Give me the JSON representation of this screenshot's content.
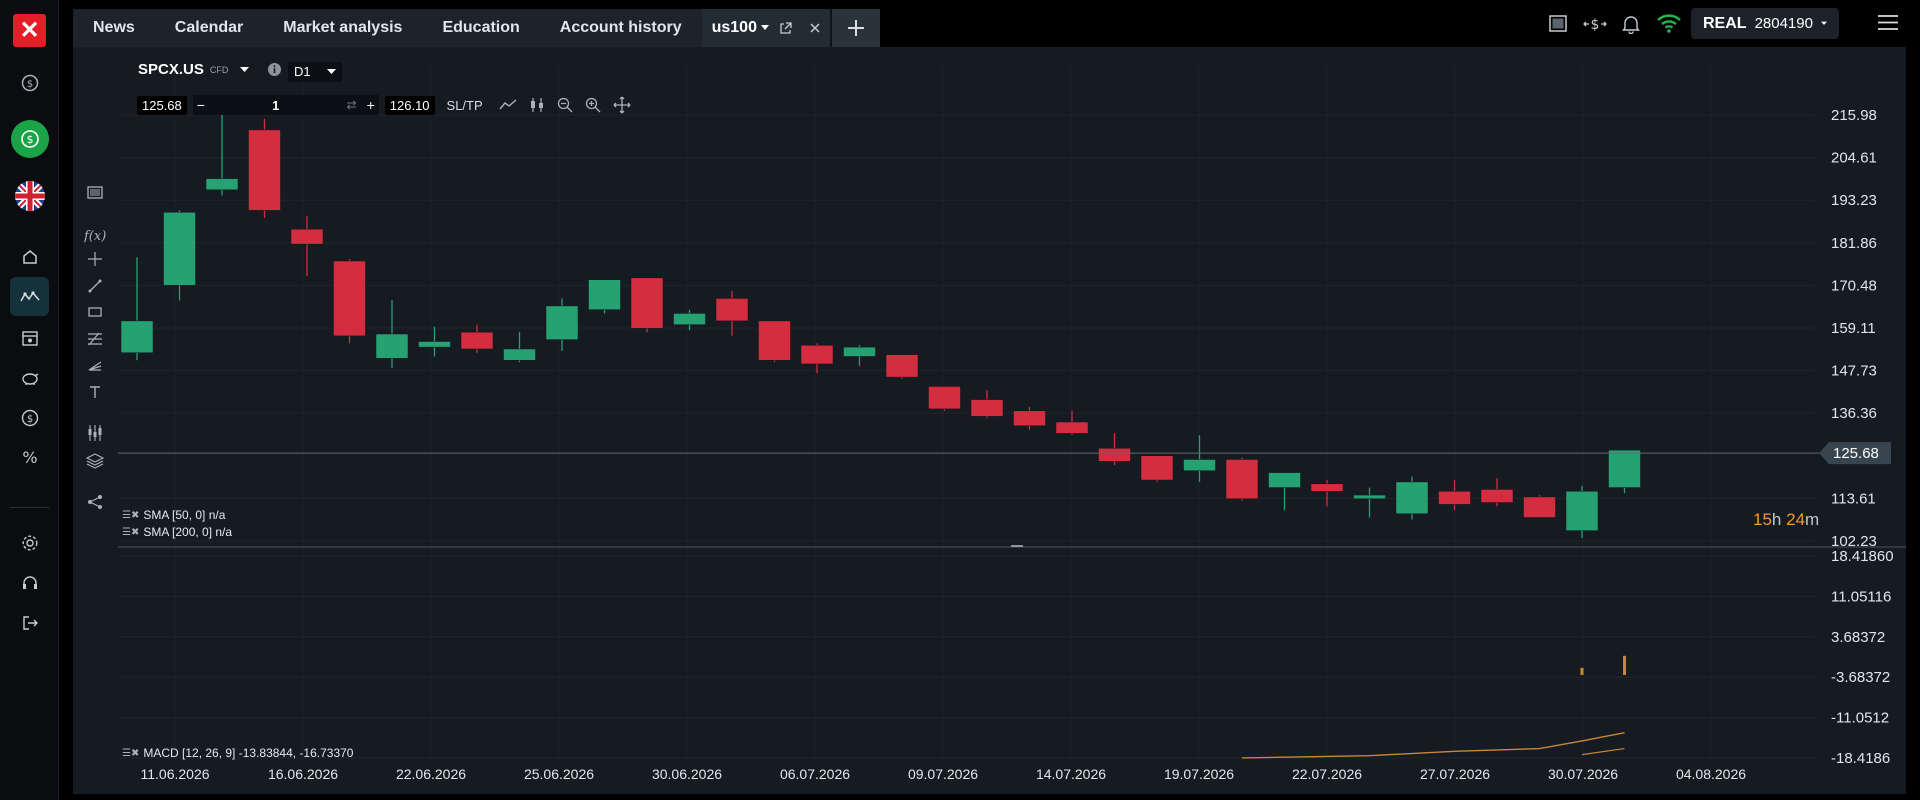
{
  "topbar": {
    "tabs": [
      "News",
      "Calendar",
      "Market analysis",
      "Education",
      "Account history"
    ],
    "symbol_tab": "us100",
    "account_type": "REAL",
    "account_number": "2804190"
  },
  "sidebar": {
    "logo": "✕",
    "items": [
      "dollar-icon",
      "deposit-icon",
      "uk-flag-icon",
      "home-icon",
      "chart-icon",
      "calendar-icon",
      "piggy-bank-icon",
      "coin-icon",
      "percent-icon",
      "settings-icon",
      "headset-icon",
      "logout-icon"
    ]
  },
  "chart": {
    "symbol": "SPCX.US",
    "symbol_type": "CFD",
    "timeframe": "D1",
    "sell_price": "125.68",
    "quantity": "1",
    "buy_price": "126.10",
    "sltp_label": "SL/TP",
    "indicators": [
      "SMA [50, 0] n/a",
      "SMA [200, 0] n/a"
    ],
    "macd_label": "MACD [12, 26, 9] -13.83844, -16.73370",
    "countdown_h": "15",
    "countdown_h_unit": "h",
    "countdown_m": "24",
    "countdown_m_unit": "m",
    "current_price_label": "125.68"
  },
  "chart_data": {
    "type": "candlestick",
    "price_ticks": [
      "215.98",
      "204.61",
      "193.23",
      "181.86",
      "170.48",
      "159.11",
      "147.73",
      "136.36",
      "125.68",
      "113.61",
      "102.23"
    ],
    "macd_ticks": [
      "18.41860",
      "11.05116",
      "3.68372",
      "-3.68372",
      "-11.0512",
      "-18.4186"
    ],
    "date_labels": [
      "11.06.2026",
      "16.06.2026",
      "22.06.2026",
      "25.06.2026",
      "30.06.2026",
      "06.07.2026",
      "09.07.2026",
      "14.07.2026",
      "19.07.2026",
      "22.07.2026",
      "27.07.2026",
      "30.07.2026",
      "04.08.2026"
    ],
    "price_range": [
      102.23,
      215.98
    ],
    "current_price": 125.68,
    "candles": [
      {
        "o": 152.5,
        "h": 178.0,
        "l": 150.5,
        "c": 161.0
      },
      {
        "o": 170.5,
        "h": 190.5,
        "l": 166.5,
        "c": 190.0
      },
      {
        "o": 196.0,
        "h": 219.0,
        "l": 194.5,
        "c": 199.0
      },
      {
        "o": 212.0,
        "h": 215.0,
        "l": 188.5,
        "c": 190.5
      },
      {
        "o": 185.5,
        "h": 189.0,
        "l": 173.0,
        "c": 181.5
      },
      {
        "o": 177.0,
        "h": 177.5,
        "l": 155.0,
        "c": 157.0
      },
      {
        "o": 151.0,
        "h": 166.5,
        "l": 148.5,
        "c": 157.5
      },
      {
        "o": 154.0,
        "h": 159.5,
        "l": 151.5,
        "c": 155.5
      },
      {
        "o": 158.0,
        "h": 160.0,
        "l": 152.5,
        "c": 153.5
      },
      {
        "o": 150.5,
        "h": 158.0,
        "l": 150.0,
        "c": 153.5
      },
      {
        "o": 156.0,
        "h": 167.0,
        "l": 153.0,
        "c": 165.0
      },
      {
        "o": 164.0,
        "h": 171.0,
        "l": 163.0,
        "c": 172.0
      },
      {
        "o": 172.5,
        "h": 172.5,
        "l": 158.0,
        "c": 159.0
      },
      {
        "o": 160.0,
        "h": 164.0,
        "l": 158.5,
        "c": 163.0
      },
      {
        "o": 167.0,
        "h": 169.0,
        "l": 157.0,
        "c": 161.0
      },
      {
        "o": 161.0,
        "h": 161.0,
        "l": 150.0,
        "c": 150.5
      },
      {
        "o": 154.5,
        "h": 155.0,
        "l": 147.0,
        "c": 149.5
      },
      {
        "o": 151.5,
        "h": 154.5,
        "l": 149.0,
        "c": 154.0
      },
      {
        "o": 152.0,
        "h": 152.0,
        "l": 145.5,
        "c": 146.0
      },
      {
        "o": 143.5,
        "h": 143.5,
        "l": 137.0,
        "c": 137.5
      },
      {
        "o": 140.0,
        "h": 142.5,
        "l": 135.0,
        "c": 135.5
      },
      {
        "o": 137.0,
        "h": 138.0,
        "l": 132.0,
        "c": 133.0
      },
      {
        "o": 134.0,
        "h": 137.0,
        "l": 130.5,
        "c": 131.0
      },
      {
        "o": 127.0,
        "h": 131.0,
        "l": 122.5,
        "c": 123.5
      },
      {
        "o": 125.0,
        "h": 125.0,
        "l": 118.0,
        "c": 118.5
      },
      {
        "o": 121.0,
        "h": 130.5,
        "l": 118.0,
        "c": 124.0
      },
      {
        "o": 124.0,
        "h": 124.5,
        "l": 113.0,
        "c": 113.5
      },
      {
        "o": 116.5,
        "h": 119.0,
        "l": 110.5,
        "c": 120.5
      },
      {
        "o": 117.5,
        "h": 118.5,
        "l": 111.5,
        "c": 115.5
      },
      {
        "o": 113.5,
        "h": 116.5,
        "l": 108.5,
        "c": 114.5
      },
      {
        "o": 109.5,
        "h": 119.5,
        "l": 108.0,
        "c": 118.0
      },
      {
        "o": 115.5,
        "h": 118.5,
        "l": 110.5,
        "c": 112.0
      },
      {
        "o": 116.0,
        "h": 119.0,
        "l": 111.5,
        "c": 112.5
      },
      {
        "o": 114.0,
        "h": 114.5,
        "l": 108.5,
        "c": 108.5
      },
      {
        "o": 105.0,
        "h": 117.0,
        "l": 103.0,
        "c": 115.5
      },
      {
        "o": 116.5,
        "h": 126.5,
        "l": 115.0,
        "c": 126.5
      }
    ],
    "macd_range": [
      -18.4186,
      18.4186
    ],
    "macd_histogram": [
      {
        "i": 34,
        "v": 1.3
      },
      {
        "i": 35,
        "v": 3.5
      }
    ],
    "macd_line": [
      {
        "i": 26,
        "v": -18.4
      },
      {
        "i": 29,
        "v": -18.0
      },
      {
        "i": 31,
        "v": -17.2
      },
      {
        "i": 33,
        "v": -16.7
      },
      {
        "i": 34,
        "v": -15.3
      },
      {
        "i": 35,
        "v": -13.8
      }
    ],
    "signal_line": [
      {
        "i": 34,
        "v": -17.8
      },
      {
        "i": 35,
        "v": -16.7
      }
    ],
    "colors": {
      "up": "#26a172",
      "down": "#d32d3f",
      "macd": "#c98735",
      "signal": "#c98735",
      "countdown": "#f39a2b"
    }
  }
}
